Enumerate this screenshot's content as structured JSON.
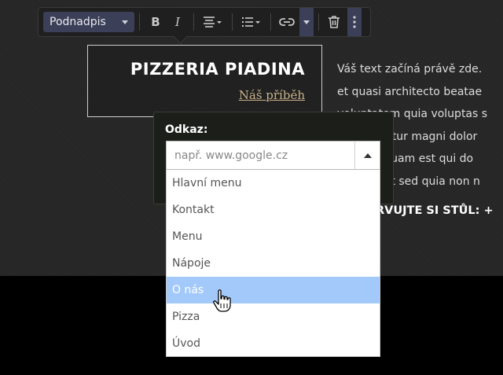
{
  "toolbar": {
    "style_select": "Podnadpis",
    "bold_label": "B",
    "italic_label": "I"
  },
  "hero": {
    "title": "PIZZERIA PIADINA",
    "link": "Náš příběh"
  },
  "body_text": {
    "lines": [
      "Váš text začíná právě zde.",
      "et quasi architecto beatae",
      "voluptatem quia voluptas s",
      "untur magni dolor",
      "squam est qui do",
      "elit sed quia non n"
    ],
    "reserve": "RVUJTE SI STŮL: +"
  },
  "link_dialog": {
    "label": "Odkaz:",
    "placeholder": "např. www.google.cz",
    "options": [
      "Hlavní menu",
      "Kontakt",
      "Menu",
      "Nápoje",
      "O nás",
      "Pizza",
      "Úvod"
    ],
    "highlighted": "O nás"
  },
  "colors": {
    "accent": "#3b3f57",
    "highlight": "#a3c9fb",
    "link": "#c9b18a"
  }
}
